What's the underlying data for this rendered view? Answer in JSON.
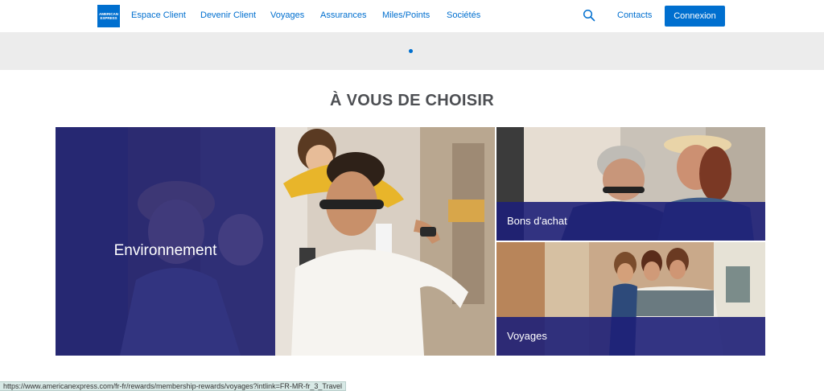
{
  "header": {
    "logo_text": [
      "AMERICAN",
      "EXPRESS"
    ],
    "nav": [
      "Espace Client",
      "Devenir Client",
      "Voyages",
      "Assurances",
      "Miles/Points",
      "Sociétés"
    ],
    "contacts_label": "Contacts",
    "login_label": "Connexion",
    "accent_color": "#006fcf"
  },
  "section": {
    "title": "À VOUS DE CHOISIR"
  },
  "tiles": {
    "environment": "Environnement",
    "vouchers": "Bons d'achat",
    "travel": "Voyages"
  },
  "status_bar": {
    "url": "https://www.americanexpress.com/fr-fr/rewards/membership-rewards/voyages?intlink=FR-MR-fr_3_Travel"
  },
  "colors": {
    "overlay": "#1e2078",
    "banner_bg": "#ececec"
  }
}
